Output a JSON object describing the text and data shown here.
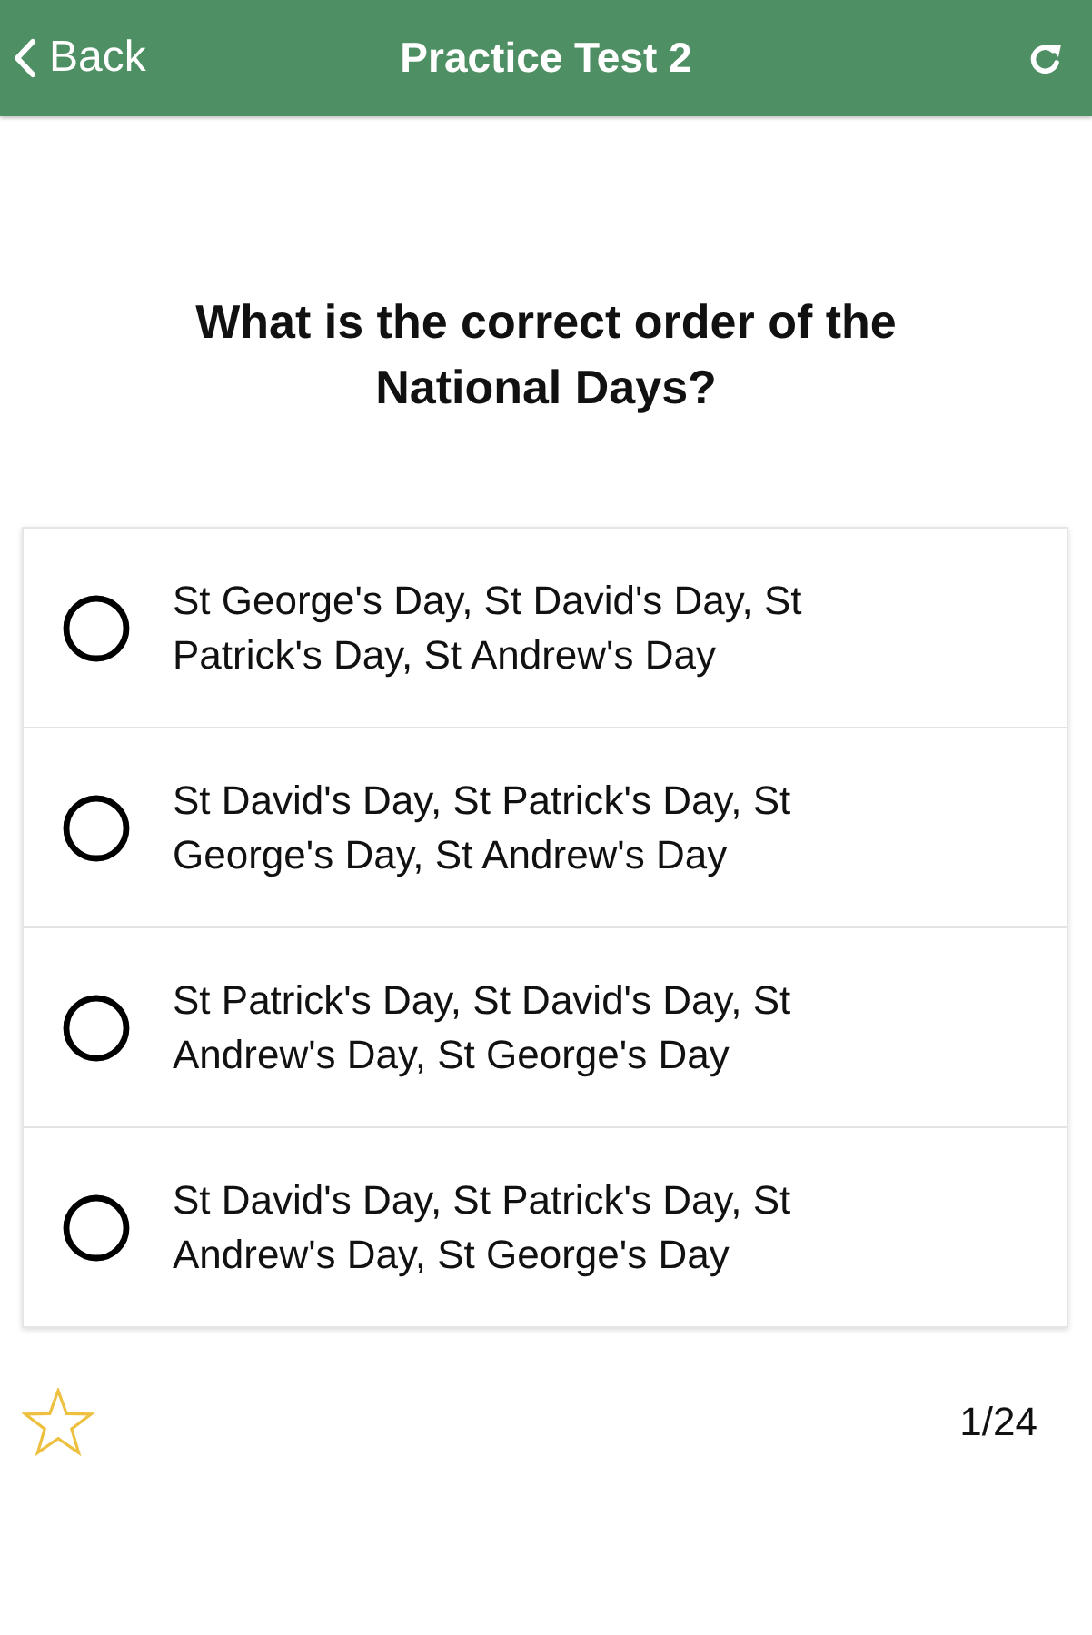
{
  "nav_bar": {
    "back_label": "Back",
    "title": "Practice Test 2"
  },
  "question": {
    "text": "What is the correct order of the National Days?"
  },
  "options": [
    {
      "label": "St George's Day, St David's Day, St Patrick's Day, St Andrew's Day",
      "selected": false
    },
    {
      "label": "St David's Day, St Patrick's Day, St George's Day, St Andrew's Day",
      "selected": false
    },
    {
      "label": "St Patrick's Day, St David's Day, St Andrew's Day, St George's Day",
      "selected": false
    },
    {
      "label": "St David's Day, St Patrick's Day, St Andrew's Day, St George's Day",
      "selected": false
    }
  ],
  "footer": {
    "bookmarked": false,
    "counter": "1/24"
  }
}
